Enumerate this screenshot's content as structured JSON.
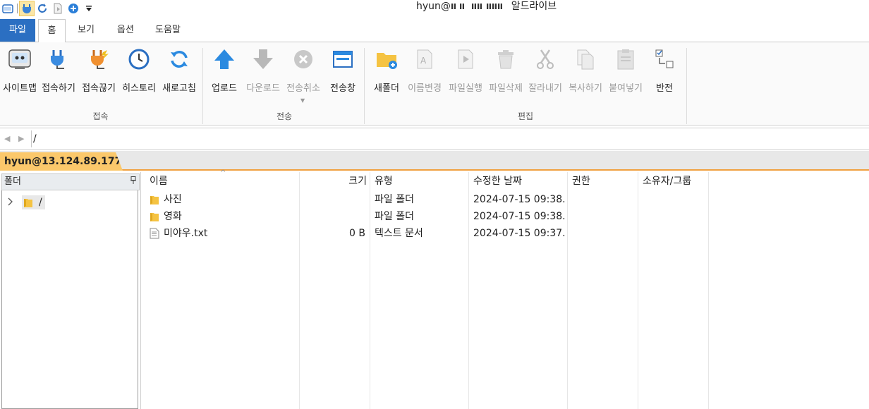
{
  "title": {
    "user_part": "hyun@",
    "app_name": "알드라이브"
  },
  "ribbon_tabs": {
    "file": "파일",
    "home": "홈",
    "view": "보기",
    "options": "옵션",
    "help": "도움말"
  },
  "ribbon": {
    "connect_group": {
      "label": "접속",
      "sitemap": "사이트맵",
      "connect": "접속하기",
      "disconnect": "접속끊기",
      "history": "히스토리",
      "refresh": "새로고침"
    },
    "transfer_group": {
      "label": "전송",
      "upload": "업로드",
      "download": "다운로드",
      "cancel": "전송취소",
      "window": "전송창"
    },
    "edit_group": {
      "label": "편집",
      "new_folder": "새폴더",
      "rename": "이름변경",
      "run_file": "파일실행",
      "delete_file": "파일삭제",
      "cut": "잘라내기",
      "copy": "복사하기",
      "paste": "붙여넣기",
      "invert": "반전"
    }
  },
  "address": {
    "path": "/"
  },
  "session": {
    "tab_label": "hyun@13.124.89.177"
  },
  "folder_pane": {
    "header": "폴더",
    "pin": "ㅁ",
    "root": "/"
  },
  "file_list": {
    "columns": {
      "name": "이름",
      "size": "크기",
      "type": "유형",
      "modified": "수정한 날짜",
      "permission": "권한",
      "owner": "소유자/그룹"
    },
    "rows": [
      {
        "name": "사진",
        "size": "",
        "type": "파일 폴더",
        "modified": "2024-07-15 09:38...",
        "permission": "",
        "owner": ""
      },
      {
        "name": "영화",
        "size": "",
        "type": "파일 폴더",
        "modified": "2024-07-15 09:38...",
        "permission": "",
        "owner": ""
      },
      {
        "name": "미야우.txt",
        "size": "0 B",
        "type": "텍스트 문서",
        "modified": "2024-07-15 09:37...",
        "permission": "",
        "owner": ""
      }
    ]
  },
  "colors": {
    "accent": "#2b6fc2",
    "session_tab": "#fbc86b",
    "session_border": "#f0a040",
    "folder": "#f5c342"
  }
}
